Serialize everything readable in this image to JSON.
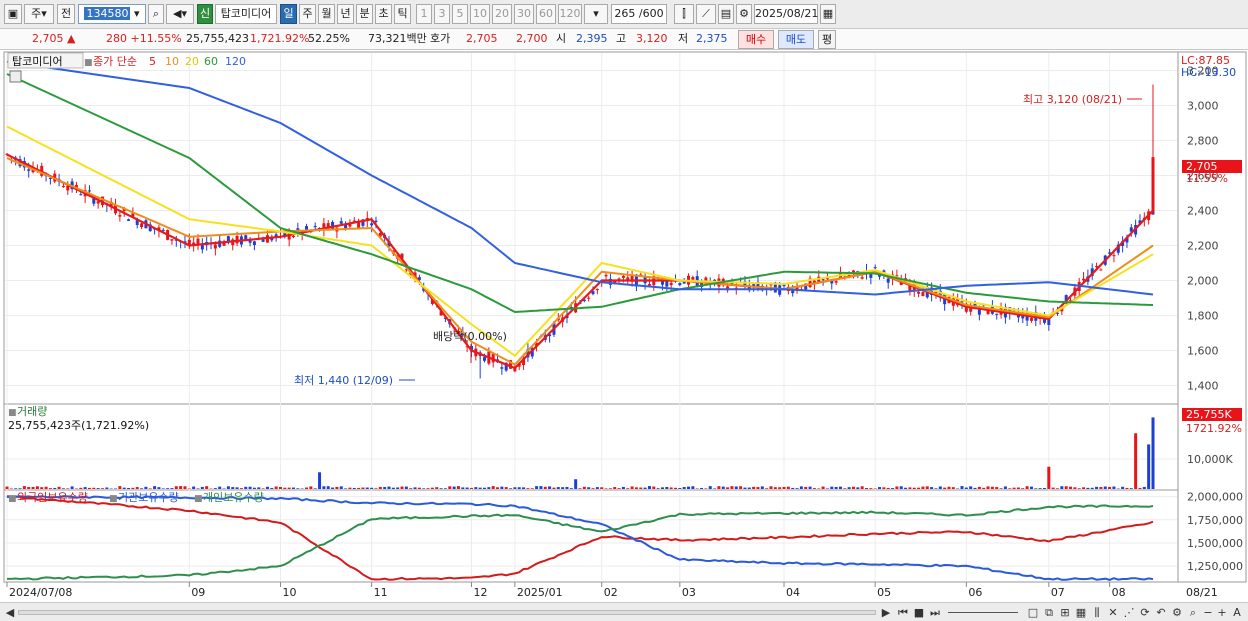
{
  "toolbar": {
    "market_btn": "주",
    "prev_btn": "전",
    "stock_code": "134580",
    "credit_tag": "신",
    "stock_name": "탑코미디어",
    "periods": [
      "일",
      "주",
      "월",
      "년",
      "분",
      "초",
      "틱"
    ],
    "active_period": "일",
    "intervals": [
      "1",
      "3",
      "5",
      "10",
      "20",
      "30",
      "60",
      "120"
    ],
    "count_display": "265 /600",
    "date": "2025/08/21"
  },
  "quote": {
    "price": "2,705",
    "change": "280 +11.55%",
    "volume": "25,755,423",
    "volume_pct": "1,721.92%",
    "turnover_pct": "52.25%",
    "amount": "73,321백만",
    "bid_label": "호가",
    "bid1": "2,705",
    "bid2": "2,700",
    "open_label": "시",
    "open": "2,395",
    "high_label": "고",
    "high": "3,120",
    "low_label": "저",
    "low": "2,375",
    "buy_btn": "매수",
    "sell_btn": "매도",
    "eval_btn": "평"
  },
  "price_panel": {
    "stock_name": "탑코미디어",
    "ma_label": "종가 단순",
    "ma_periods": [
      "5",
      "10",
      "20",
      "60",
      "120"
    ],
    "lc": "LC:87.85",
    "hc": "HC:-13.30",
    "current_tag": "2,705",
    "current_pct": "11.55%",
    "annotation_high": "최고 3,120 (08/21)",
    "annotation_low": "최저 1,440 (12/09)",
    "annotation_div": "배당락(0.00%)",
    "yticks": [
      "3,200",
      "3,000",
      "2,800",
      "2,600",
      "2,400",
      "2,200",
      "2,000",
      "1,800",
      "1,600",
      "1,400"
    ]
  },
  "volume_panel": {
    "title": "거래량",
    "info": "25,755,423주(1,721.92%)",
    "tag": "25,755K",
    "tag_pct": "1721.92%",
    "yticks": [
      "10,000K"
    ]
  },
  "holdings_panel": {
    "legend": [
      "외국인보유수량",
      "기관보유수량",
      "개인보유수량"
    ],
    "yticks": [
      "2,000,000",
      "1,750,000",
      "1,500,000",
      "1,250,000"
    ]
  },
  "xaxis": {
    "labels": [
      "2024/07/08",
      "09",
      "10",
      "11",
      "12",
      "2025/01",
      "02",
      "03",
      "04",
      "05",
      "06",
      "07",
      "08"
    ],
    "right_label": "08/21"
  },
  "colors": {
    "candle_up": "#e8141a",
    "candle_down": "#1c3fd6",
    "ma5": "#e41a1c",
    "ma10": "#f08c1a",
    "ma20": "#f5e21e",
    "ma60": "#2a9a3c",
    "ma120": "#3060e0",
    "foreign": "#d41a1a",
    "institution": "#2a5ad8",
    "individual": "#2e8f4d"
  },
  "chart_data": {
    "type": "line",
    "title": "탑코미디어",
    "x": [
      "2024/07/08",
      "09",
      "10",
      "11",
      "12",
      "2025/01",
      "02",
      "03",
      "04",
      "05",
      "06",
      "07",
      "08/21"
    ],
    "series": [
      {
        "name": "5",
        "values": [
          2720,
          2200,
          2250,
          2350,
          1600,
          1500,
          2000,
          2000,
          1950,
          2050,
          1850,
          1780,
          2400
        ]
      },
      {
        "name": "10",
        "values": [
          2700,
          2250,
          2280,
          2300,
          1650,
          1520,
          2050,
          2000,
          1950,
          2050,
          1860,
          1790,
          2200
        ]
      },
      {
        "name": "20",
        "values": [
          2880,
          2350,
          2280,
          2200,
          1750,
          1570,
          2100,
          2000,
          1980,
          2060,
          1880,
          1800,
          2150
        ]
      },
      {
        "name": "60",
        "values": [
          3180,
          2700,
          2300,
          2150,
          1950,
          1820,
          1850,
          1950,
          2050,
          2040,
          1930,
          1880,
          1860
        ]
      },
      {
        "name": "120",
        "values": [
          3250,
          3100,
          2900,
          2600,
          2300,
          2100,
          1990,
          1950,
          1950,
          1920,
          1970,
          1990,
          1920
        ]
      }
    ],
    "ylim": [
      1300,
      3300
    ]
  }
}
